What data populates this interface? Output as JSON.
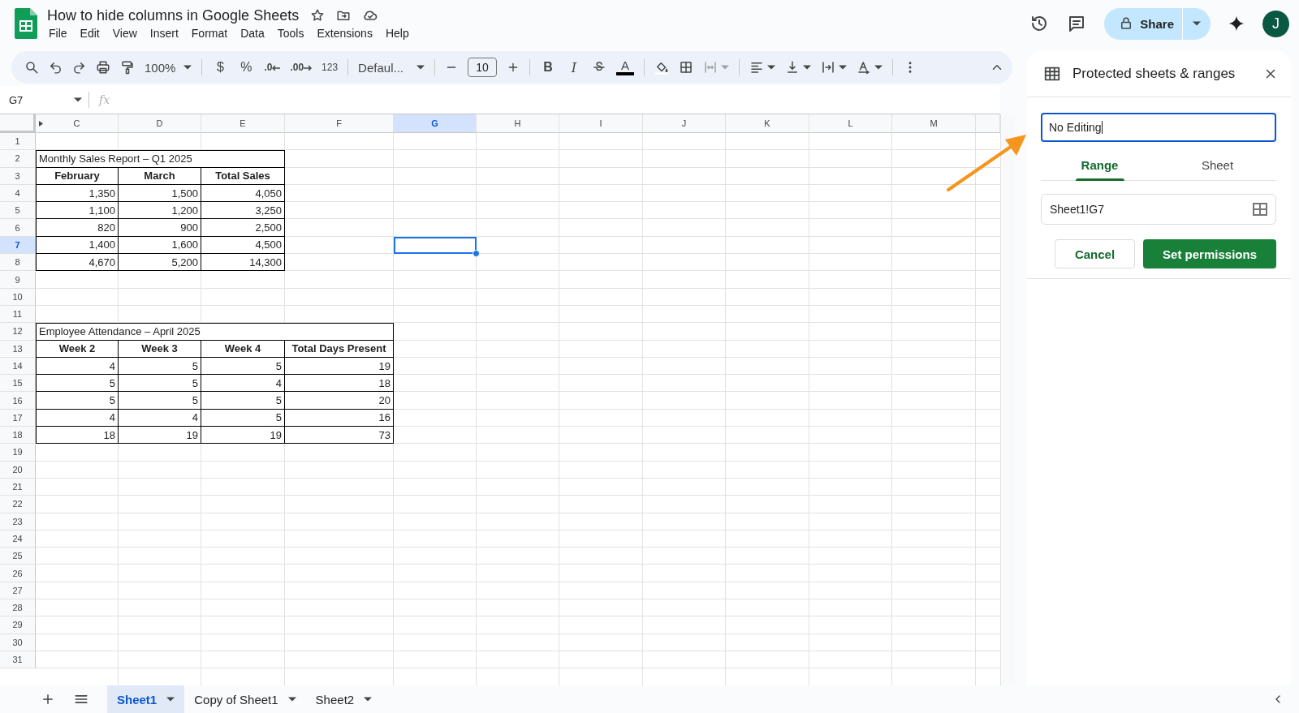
{
  "app": {
    "title": "How to hide columns in Google Sheets",
    "menu": [
      "File",
      "Edit",
      "View",
      "Insert",
      "Format",
      "Data",
      "Tools",
      "Extensions",
      "Help"
    ],
    "share": "Share",
    "avatar": "J"
  },
  "toolbar": {
    "zoom": "100%",
    "currency": "$",
    "percent": "%",
    "decrease_decimals": ".0",
    "increase_decimals": ".00",
    "number_format": "123",
    "font": "Defaul...",
    "font_size": "10",
    "bold": "B",
    "italic": "I",
    "text_color": "A"
  },
  "formula_bar": {
    "name_box": "G7",
    "function_label": "fx"
  },
  "grid": {
    "columns": [
      {
        "label": "C",
        "selected": false
      },
      {
        "label": "D",
        "selected": false
      },
      {
        "label": "E",
        "selected": false
      },
      {
        "label": "F",
        "selected": false
      },
      {
        "label": "G",
        "selected": true
      },
      {
        "label": "H",
        "selected": false
      },
      {
        "label": "I",
        "selected": false
      },
      {
        "label": "J",
        "selected": false
      },
      {
        "label": "K",
        "selected": false
      },
      {
        "label": "L",
        "selected": false
      },
      {
        "label": "M",
        "selected": false
      }
    ],
    "rows": [
      {
        "label": "1",
        "selected": false
      },
      {
        "label": "2",
        "selected": false
      },
      {
        "label": "3",
        "selected": false
      },
      {
        "label": "4",
        "selected": false
      },
      {
        "label": "5",
        "selected": false
      },
      {
        "label": "6",
        "selected": false
      },
      {
        "label": "7",
        "selected": true
      },
      {
        "label": "8",
        "selected": false
      },
      {
        "label": "9",
        "selected": false
      },
      {
        "label": "10",
        "selected": false
      },
      {
        "label": "11",
        "selected": false
      },
      {
        "label": "12",
        "selected": false
      },
      {
        "label": "13",
        "selected": false
      },
      {
        "label": "14",
        "selected": false
      },
      {
        "label": "15",
        "selected": false
      },
      {
        "label": "16",
        "selected": false
      },
      {
        "label": "17",
        "selected": false
      },
      {
        "label": "18",
        "selected": false
      },
      {
        "label": "19",
        "selected": false
      },
      {
        "label": "20",
        "selected": false
      },
      {
        "label": "21",
        "selected": false
      },
      {
        "label": "22",
        "selected": false
      },
      {
        "label": "23",
        "selected": false
      },
      {
        "label": "24",
        "selected": false
      },
      {
        "label": "25",
        "selected": false
      },
      {
        "label": "26",
        "selected": false
      },
      {
        "label": "27",
        "selected": false
      },
      {
        "label": "28",
        "selected": false
      },
      {
        "label": "29",
        "selected": false
      },
      {
        "label": "30",
        "selected": false
      },
      {
        "label": "31",
        "selected": false
      }
    ],
    "tables": [
      {
        "title": "Monthly Sales Report – Q1 2025",
        "headers": [
          "February",
          "March",
          "Total Sales"
        ],
        "rows": [
          [
            "1,350",
            "1,500",
            "4,050"
          ],
          [
            "1,100",
            "1,200",
            "3,250"
          ],
          [
            "820",
            "900",
            "2,500"
          ],
          [
            "1,400",
            "1,600",
            "4,500"
          ],
          [
            "4,670",
            "5,200",
            "14,300"
          ]
        ]
      },
      {
        "title": "Employee Attendance – April 2025",
        "headers": [
          "Week 2",
          "Week 3",
          "Week 4",
          "Total Days Present"
        ],
        "rows": [
          [
            "4",
            "5",
            "5",
            "19"
          ],
          [
            "5",
            "5",
            "4",
            "18"
          ],
          [
            "5",
            "5",
            "5",
            "20"
          ],
          [
            "4",
            "4",
            "5",
            "16"
          ],
          [
            "18",
            "19",
            "19",
            "73"
          ]
        ]
      }
    ]
  },
  "panel": {
    "title": "Protected sheets & ranges",
    "description": {
      "value": "No Editing"
    },
    "tabs": [
      {
        "label": "Range",
        "selected": true
      },
      {
        "label": "Sheet",
        "selected": false
      }
    ],
    "range": {
      "value": "Sheet1!G7"
    },
    "buttons": [
      {
        "label": "Cancel",
        "kind": "secondary"
      },
      {
        "label": "Set permissions",
        "kind": "primary"
      }
    ]
  },
  "sheet_tabs": [
    {
      "label": "Sheet1",
      "selected": true
    },
    {
      "label": "Copy of Sheet1",
      "selected": false
    },
    {
      "label": "Sheet2",
      "selected": false
    }
  ]
}
